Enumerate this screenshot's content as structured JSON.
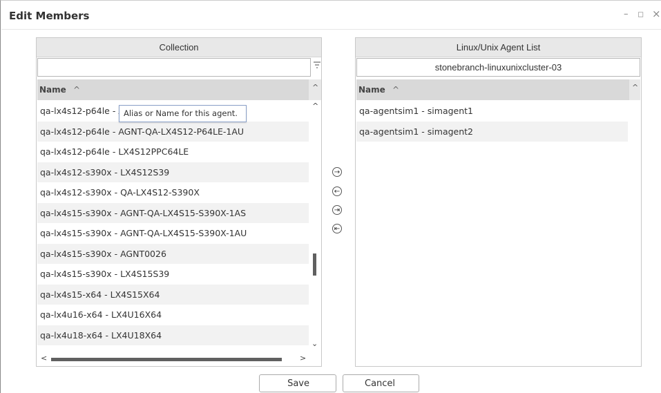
{
  "dialog": {
    "title": "Edit Members",
    "minimize_glyph": "–",
    "maximize_glyph": "◻",
    "close_glyph": "×"
  },
  "left_panel": {
    "header": "Collection",
    "filter_value": "",
    "column_header": "Name",
    "sort_glyph": "^",
    "tooltip": "Alias or Name for this agent.",
    "rows": [
      "qa-lx4s12-p64le - AGNT-QA-LX4S12-P64LE-1AS",
      "qa-lx4s12-p64le - AGNT-QA-LX4S12-P64LE-1AU",
      "qa-lx4s12-p64le - LX4S12PPC64LE",
      "qa-lx4s12-s390x - LX4S12S39",
      "qa-lx4s12-s390x - QA-LX4S12-S390X",
      "qa-lx4s15-s390x - AGNT-QA-LX4S15-S390X-1AS",
      "qa-lx4s15-s390x - AGNT-QA-LX4S15-S390X-1AU",
      "qa-lx4s15-s390x - AGNT0026",
      "qa-lx4s15-s390x - LX4S15S39",
      "qa-lx4s15-x64 - LX4S15X64",
      "qa-lx4u16-x64 - LX4U16X64",
      "qa-lx4u18-x64 - LX4U18X64"
    ],
    "scroll_up_glyph": "^",
    "scroll_down_glyph": "⌄",
    "scroll_left_glyph": "<",
    "scroll_right_glyph": ">"
  },
  "transfer_buttons": {
    "move_right": "→",
    "move_left": "←",
    "move_all_right": "⇥",
    "move_all_left": "⇤"
  },
  "right_panel": {
    "header": "Linux/Unix Agent List",
    "cluster_value": "stonebranch-linuxunixcluster-03",
    "column_header": "Name",
    "sort_glyph": "^",
    "rows": [
      "qa-agentsim1 - simagent1",
      "qa-agentsim1 - simagent2"
    ]
  },
  "footer": {
    "save_label": "Save",
    "cancel_label": "Cancel"
  }
}
